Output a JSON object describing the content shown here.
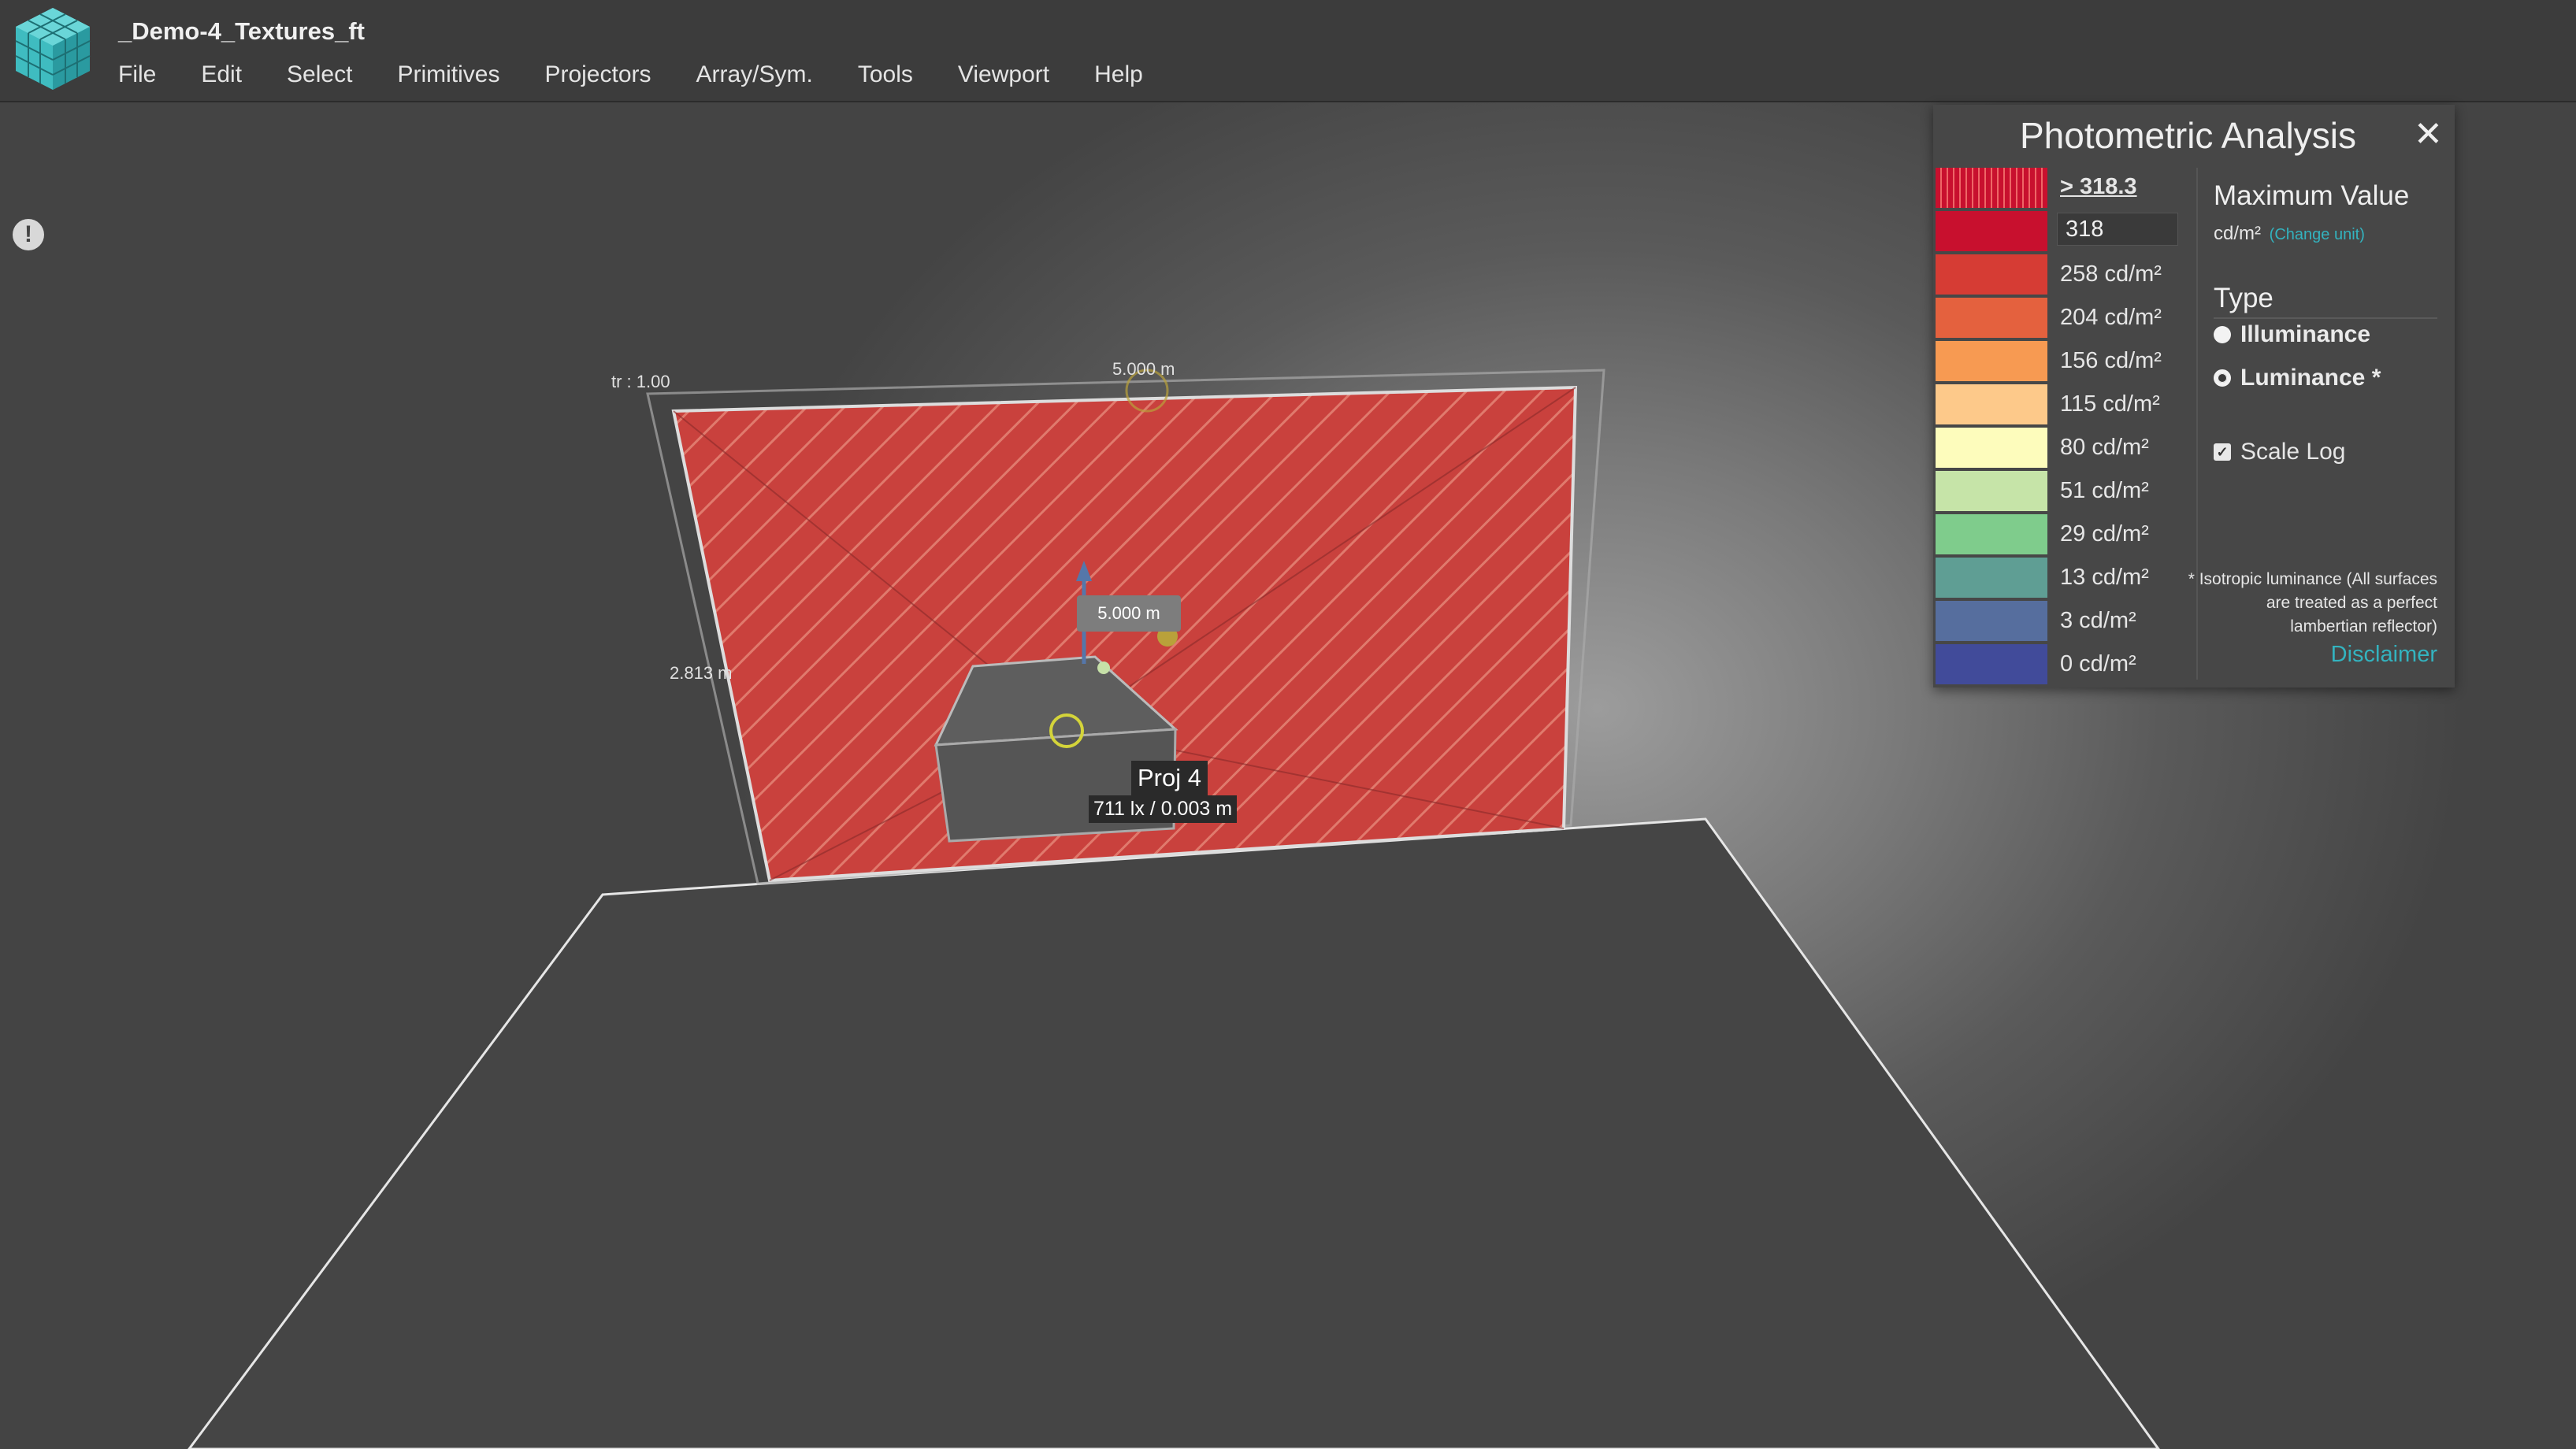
{
  "app": {
    "document_title": "_Demo-4_Textures_ft"
  },
  "menu": [
    "File",
    "Edit",
    "Select",
    "Primitives",
    "Projectors",
    "Array/Sym.",
    "Tools",
    "Viewport",
    "Help"
  ],
  "viewport": {
    "alert_icon": "exclamation-icon",
    "labels": {
      "tr": "tr : 1.00",
      "top_dim": "5.000 m",
      "side_dim": "2.813 m",
      "dim_badge": "5.000 m",
      "projector_name": "Proj 4",
      "projector_measure": "711 lx / 0.003 m"
    }
  },
  "panel": {
    "title": "Photometric Analysis",
    "close_icon": "close-icon",
    "legend": {
      "max_link": "> 318.3",
      "max_input_value": "318",
      "labels": [
        "258 cd/m²",
        "204 cd/m²",
        "156 cd/m²",
        "115 cd/m²",
        "80 cd/m²",
        "51 cd/m²",
        "29 cd/m²",
        "13 cd/m²",
        "3 cd/m²",
        "0 cd/m²"
      ],
      "colors": [
        "#c8102e",
        "#d63c34",
        "#e4613e",
        "#f79a52",
        "#fdc98a",
        "#fdfcbc",
        "#c6e4a8",
        "#7fcc8c",
        "#5f9e94",
        "#566e9e",
        "#414b9a"
      ]
    },
    "max_value": {
      "title": "Maximum Value",
      "unit": "cd/m²",
      "change_unit": "(Change unit)"
    },
    "type": {
      "title": "Type",
      "options": [
        {
          "label": "Illuminance",
          "selected": false
        },
        {
          "label": "Luminance *",
          "selected": true
        }
      ]
    },
    "scale_log": {
      "label": "Scale Log",
      "checked": true
    },
    "note": "* Isotropic luminance (All surfaces are treated as a perfect lambertian reflector)",
    "disclaimer": "Disclaimer"
  }
}
